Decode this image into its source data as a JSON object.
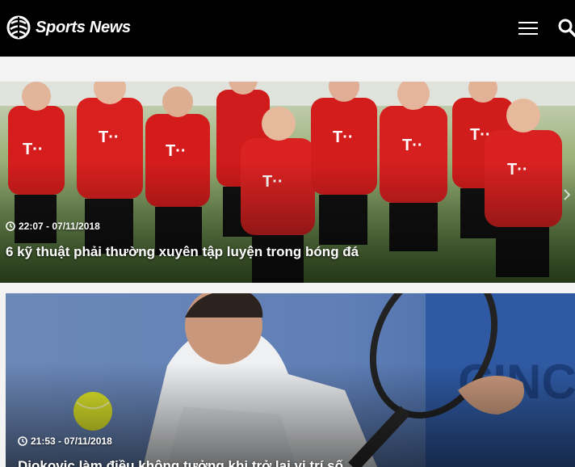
{
  "header": {
    "brand": "Sports News",
    "menu_icon": "hamburger-menu-icon",
    "search_icon": "search-icon",
    "background": "#000000"
  },
  "articles": [
    {
      "time": "22:07 - 07/11/2018",
      "title": "6 kỹ thuật phải thường xuyên tập luyện trong bóng đá",
      "image": "football-team-training-photo"
    },
    {
      "time": "21:53 - 07/11/2018",
      "title": "Djokovic làm điều không tưởng khi trở lại vị trí số",
      "image": "tennis-player-photo"
    }
  ]
}
